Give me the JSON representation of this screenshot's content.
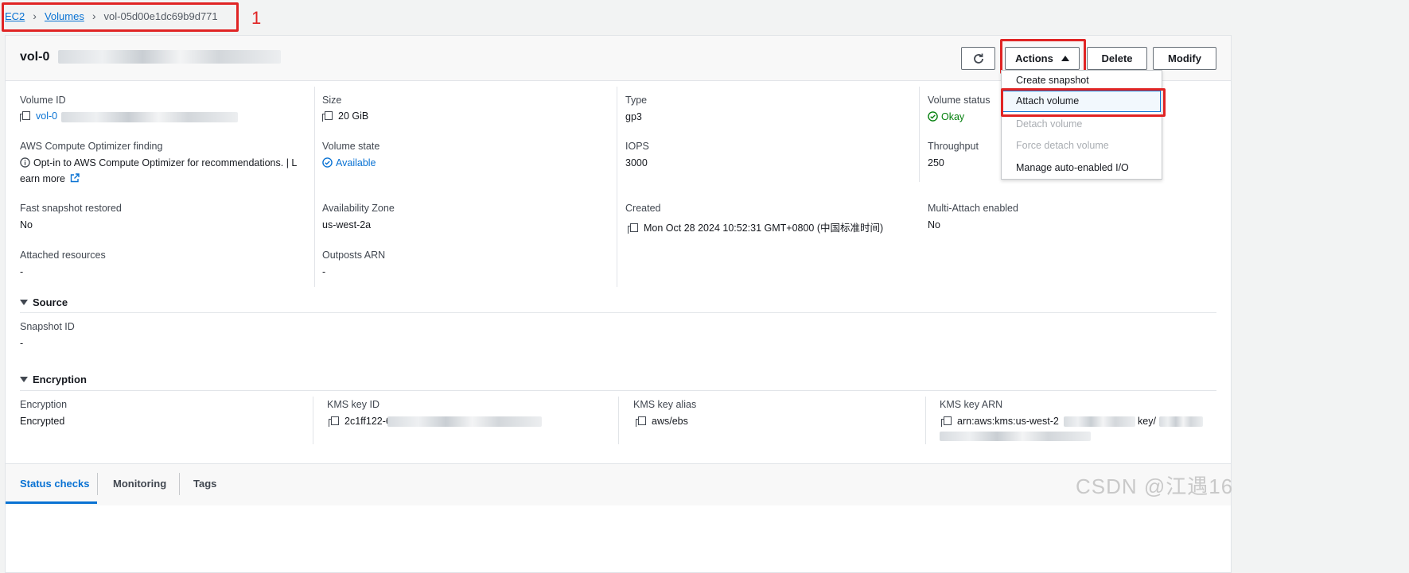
{
  "breadcrumb": {
    "items": [
      {
        "label": "EC2"
      },
      {
        "label": "Volumes"
      }
    ],
    "current": "vol-05d00e1dc69b9d771"
  },
  "annotation": {
    "step_number": "1"
  },
  "header": {
    "title": "vol-0",
    "refresh_icon": "refresh-icon",
    "actions_label": "Actions",
    "delete_label": "Delete",
    "modify_label": "Modify"
  },
  "actions_menu": {
    "items": [
      {
        "label": "Create snapshot",
        "disabled": false
      },
      {
        "label": "Attach volume",
        "disabled": false
      },
      {
        "label": "Detach volume",
        "disabled": true
      },
      {
        "label": "Force detach volume",
        "disabled": true
      },
      {
        "label": "Manage auto-enabled I/O",
        "disabled": false
      }
    ]
  },
  "details": {
    "volume_id": {
      "label": "Volume ID",
      "value": "vol-0"
    },
    "size": {
      "label": "Size",
      "value": "20 GiB"
    },
    "type": {
      "label": "Type",
      "value": "gp3"
    },
    "volume_status": {
      "label": "Volume status",
      "value": "Okay"
    },
    "optimizer": {
      "label": "AWS Compute Optimizer finding",
      "value": "Opt-in to AWS Compute Optimizer for recommendations. | L",
      "link": "earn more"
    },
    "volume_state": {
      "label": "Volume state",
      "value": "Available"
    },
    "iops": {
      "label": "IOPS",
      "value": "3000"
    },
    "throughput": {
      "label": "Throughput",
      "value": "250"
    },
    "fast_snapshot": {
      "label": "Fast snapshot restored",
      "value": "No"
    },
    "az": {
      "label": "Availability Zone",
      "value": "us-west-2a"
    },
    "created": {
      "label": "Created",
      "value": "Mon Oct 28 2024 10:52:31 GMT+0800 (中国标准时间)"
    },
    "multi_attach": {
      "label": "Multi-Attach enabled",
      "value": "No"
    },
    "attached": {
      "label": "Attached resources",
      "value": "-"
    },
    "outposts": {
      "label": "Outposts ARN",
      "value": "-"
    }
  },
  "source": {
    "title": "Source",
    "snapshot_label": "Snapshot ID",
    "snapshot_value": "-"
  },
  "encryption": {
    "title": "Encryption",
    "encryption_label": "Encryption",
    "encryption_value": "Encrypted",
    "kms_id_label": "KMS key ID",
    "kms_id_value": "2c1ff122-626",
    "kms_alias_label": "KMS key alias",
    "kms_alias_value": "aws/ebs",
    "kms_arn_label": "KMS key ARN",
    "kms_arn_value": "arn:aws:kms:us-west-2",
    "kms_arn_suffix": "key/"
  },
  "tabs": [
    {
      "label": "Status checks",
      "active": true
    },
    {
      "label": "Monitoring",
      "active": false
    },
    {
      "label": "Tags",
      "active": false
    }
  ],
  "watermark": "CSDN @江遇16",
  "colors": {
    "link": "#0972d3",
    "success": "#037f0c",
    "highlight": "#e02424"
  }
}
